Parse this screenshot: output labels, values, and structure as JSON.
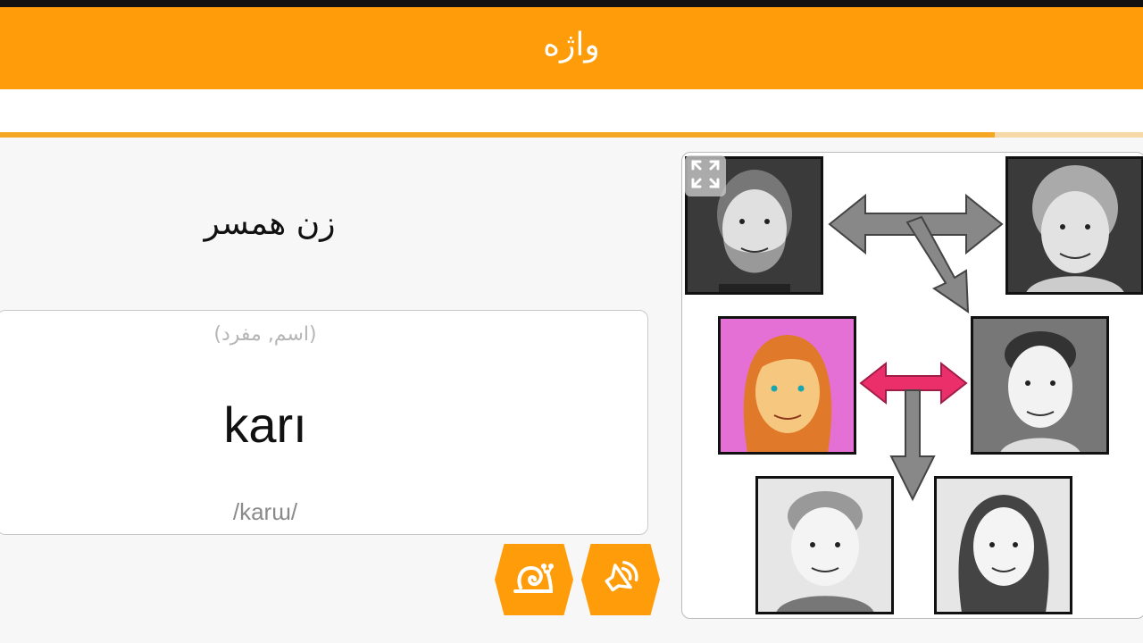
{
  "header": {
    "title": "واژه"
  },
  "progress": {
    "fraction": 0.87
  },
  "card": {
    "translation": "زن همسر",
    "part_of_speech": "(اسم, مفرد)",
    "word": "karı",
    "pronunciation": "/karɯ/"
  },
  "buttons": {
    "slow_audio_icon": "snail-icon",
    "audio_icon": "speaker-icon"
  },
  "illustration": {
    "expand_icon": "expand-icon",
    "colors": {
      "highlight_bg": "#e46fd5",
      "highlight_arrow": "#ea2f6a",
      "arrow": "#888888"
    }
  },
  "colors": {
    "accent": "#ff9c0a",
    "background": "#f7f7f7"
  }
}
